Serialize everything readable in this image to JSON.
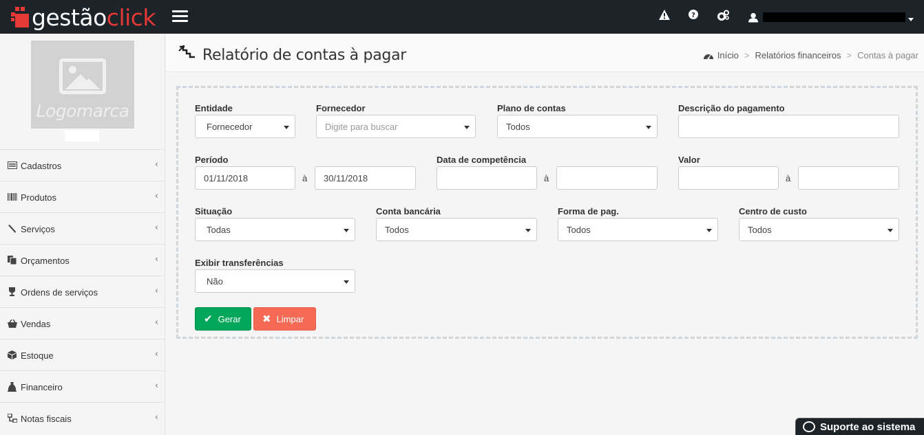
{
  "brand": {
    "part1": "gestão",
    "part2": "click"
  },
  "sidebar": {
    "logo_placeholder": "Logomarca",
    "items": [
      {
        "label": "Cadastros",
        "icon": "list-card-icon"
      },
      {
        "label": "Produtos",
        "icon": "barcode-icon"
      },
      {
        "label": "Serviços",
        "icon": "wrench-icon"
      },
      {
        "label": "Orçamentos",
        "icon": "documents-icon"
      },
      {
        "label": "Ordens de serviços",
        "icon": "trophy-icon"
      },
      {
        "label": "Vendas",
        "icon": "basket-icon"
      },
      {
        "label": "Estoque",
        "icon": "cube-icon"
      },
      {
        "label": "Financeiro",
        "icon": "money-bag-icon"
      },
      {
        "label": "Notas fiscais",
        "icon": "sitemap-icon"
      }
    ]
  },
  "header": {
    "title": "Relatório de contas à pagar",
    "breadcrumb": {
      "home": "Início",
      "parent": "Relatórios financeiros",
      "current": "Contas à pagar",
      "separator": ">"
    }
  },
  "form": {
    "entidade": {
      "label": "Entidade",
      "value": "Fornecedor"
    },
    "fornecedor": {
      "label": "Fornecedor",
      "placeholder": "Digite para buscar"
    },
    "plano_contas": {
      "label": "Plano de contas",
      "value": "Todos"
    },
    "descricao": {
      "label": "Descrição do pagamento",
      "value": ""
    },
    "periodo": {
      "label": "Período",
      "from": "01/11/2018",
      "to": "30/11/2018"
    },
    "competencia": {
      "label": "Data de competência",
      "from": "",
      "to": ""
    },
    "valor": {
      "label": "Valor",
      "from": "",
      "to": ""
    },
    "range_separator": "à",
    "situacao": {
      "label": "Situação",
      "value": "Todas"
    },
    "conta_bancaria": {
      "label": "Conta bancária",
      "value": "Todos"
    },
    "forma_pag": {
      "label": "Forma de pag.",
      "value": "Todos"
    },
    "centro_custo": {
      "label": "Centro de custo",
      "value": "Todos"
    },
    "transferencias": {
      "label": "Exibir transferências",
      "value": "Não"
    }
  },
  "buttons": {
    "gerar": "Gerar",
    "limpar": "Limpar"
  },
  "support": {
    "label": "Suporte ao sistema"
  },
  "colors": {
    "topbar": "#1c2329",
    "brand_accent": "#e53935",
    "gerar": "#00a65a",
    "limpar": "#f46a55"
  }
}
